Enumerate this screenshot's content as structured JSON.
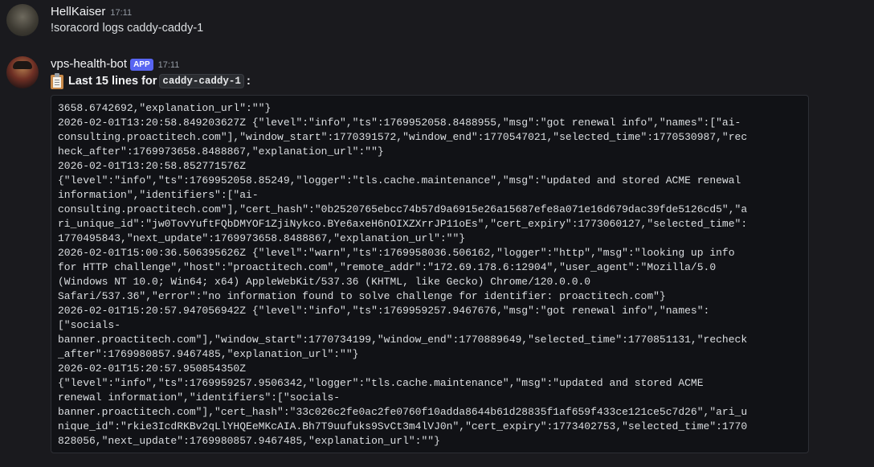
{
  "messages": [
    {
      "username": "HellKaiser",
      "timestamp": "17:11",
      "content": "!soracord logs caddy-caddy-1"
    },
    {
      "username": "vps-health-bot",
      "badge": "APP",
      "timestamp": "17:11",
      "icon": "clipboard-icon",
      "content_prefix": "Last 15 lines for",
      "content_code": "caddy-caddy-1",
      "content_suffix": ":",
      "log_lines": [
        "3658.6742692,\"explanation_url\":\"\"}",
        "2026-02-01T13:20:58.849203627Z {\"level\":\"info\",\"ts\":1769952058.8488955,\"msg\":\"got renewal info\",\"names\":[\"ai-",
        "consulting.proactitech.com\"],\"window_start\":1770391572,\"window_end\":1770547021,\"selected_time\":1770530987,\"rec",
        "heck_after\":1769973658.8488867,\"explanation_url\":\"\"}",
        "2026-02-01T13:20:58.852771576Z",
        "{\"level\":\"info\",\"ts\":1769952058.85249,\"logger\":\"tls.cache.maintenance\",\"msg\":\"updated and stored ACME renewal",
        "information\",\"identifiers\":[\"ai-",
        "consulting.proactitech.com\"],\"cert_hash\":\"0b2520765ebcc74b57d9a6915e26a15687efe8a071e16d679dac39fde5126cd5\",\"a",
        "ri_unique_id\":\"jw0TovYuftFQbDMYOF1ZjiNykco.BYe6axeH6nOIXZXrrJP11oEs\",\"cert_expiry\":1773060127,\"selected_time\":",
        "1770495843,\"next_update\":1769973658.8488867,\"explanation_url\":\"\"}",
        "2026-02-01T15:00:36.506395626Z {\"level\":\"warn\",\"ts\":1769958036.506162,\"logger\":\"http\",\"msg\":\"looking up info",
        "for HTTP challenge\",\"host\":\"proactitech.com\",\"remote_addr\":\"172.69.178.6:12904\",\"user_agent\":\"Mozilla/5.0",
        "(Windows NT 10.0; Win64; x64) AppleWebKit/537.36 (KHTML, like Gecko) Chrome/120.0.0.0",
        "Safari/537.36\",\"error\":\"no information found to solve challenge for identifier: proactitech.com\"}",
        "2026-02-01T15:20:57.947056942Z {\"level\":\"info\",\"ts\":1769959257.9467676,\"msg\":\"got renewal info\",\"names\":",
        "[\"socials-",
        "banner.proactitech.com\"],\"window_start\":1770734199,\"window_end\":1770889649,\"selected_time\":1770851131,\"recheck",
        "_after\":1769980857.9467485,\"explanation_url\":\"\"}",
        "2026-02-01T15:20:57.950854350Z",
        "{\"level\":\"info\",\"ts\":1769959257.9506342,\"logger\":\"tls.cache.maintenance\",\"msg\":\"updated and stored ACME",
        "renewal information\",\"identifiers\":[\"socials-",
        "banner.proactitech.com\"],\"cert_hash\":\"33c026c2fe0ac2fe0760f10adda8644b61d28835f1af659f433ce121ce5c7d26\",\"ari_u",
        "nique_id\":\"rkie3IcdRKBv2qLlYHQEeMKcAIA.Bh7T9uufuks9SvCt3m4lVJ0n\",\"cert_expiry\":1773402753,\"selected_time\":1770",
        "828056,\"next_update\":1769980857.9467485,\"explanation_url\":\"\"}"
      ]
    }
  ]
}
